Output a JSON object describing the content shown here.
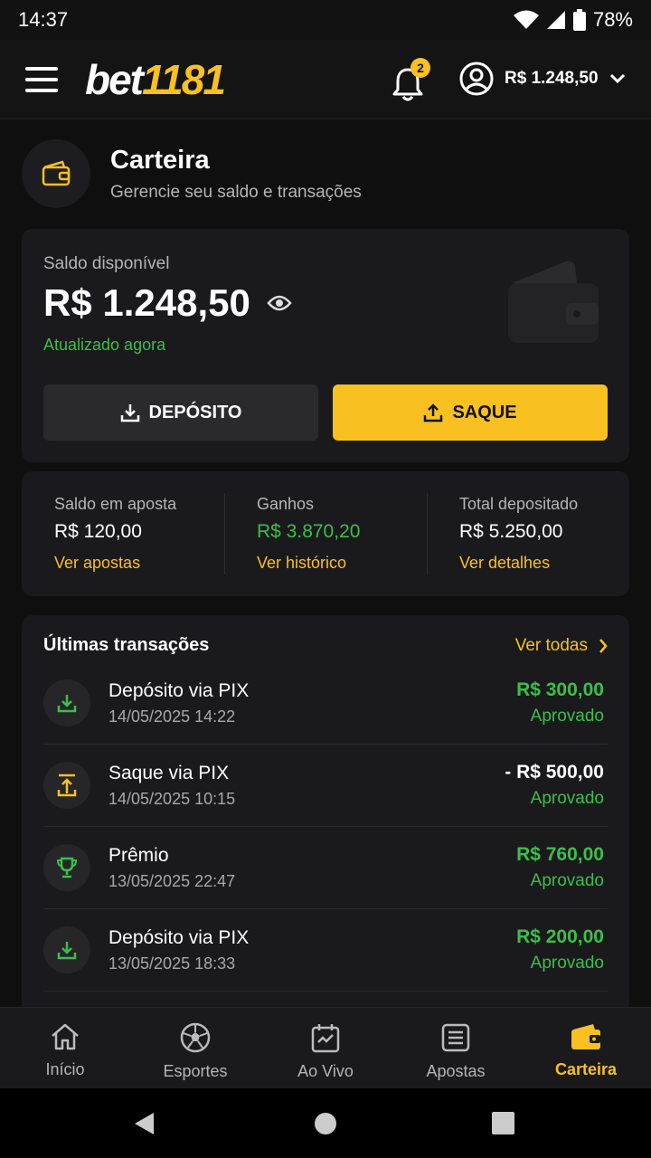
{
  "status_bar": {
    "time": "14:37",
    "battery": "78%"
  },
  "app_bar": {
    "logo_white": "bet",
    "logo_yellow": "1181",
    "notification_count": "2",
    "account_balance": "R$ 1.248,50"
  },
  "page": {
    "title": "Carteira",
    "subtitle": "Gerencie seu saldo e transações"
  },
  "balance": {
    "label": "Saldo disponível",
    "amount": "R$ 1.248,50",
    "updated": "Atualizado agora",
    "deposit_label": "DEPÓSITO",
    "withdraw_label": "SAQUE"
  },
  "stats": [
    {
      "label": "Saldo em aposta",
      "value": "R$ 120,00",
      "link": "Ver apostas"
    },
    {
      "label": "Ganhos",
      "value": "R$ 3.870,20",
      "link": "Ver histórico"
    },
    {
      "label": "Total depositado",
      "value": "R$ 5.250,00",
      "link": "Ver detalhes"
    }
  ],
  "transactions": {
    "title": "Últimas transações",
    "see_all": "Ver todas",
    "items": [
      {
        "name": "Depósito via PIX",
        "date": "14/05/2025 14:22",
        "value": "R$ 300,00",
        "status": "Aprovado",
        "icon": "download-icon"
      },
      {
        "name": "Saque via PIX",
        "date": "14/05/2025 10:15",
        "value": "- R$ 500,00",
        "status": "Aprovado",
        "icon": "upload-icon"
      },
      {
        "name": "Prêmio",
        "date": "13/05/2025 22:47",
        "value": "R$ 760,00",
        "status": "Aprovado",
        "icon": "trophy-icon"
      },
      {
        "name": "Depósito via PIX",
        "date": "13/05/2025 18:33",
        "value": "R$ 200,00",
        "status": "Aprovado",
        "icon": "download-icon"
      }
    ]
  },
  "bottom_nav": [
    {
      "label": "Início",
      "icon": "home-icon"
    },
    {
      "label": "Esportes",
      "icon": "soccer-ball-icon"
    },
    {
      "label": "Ao Vivo",
      "icon": "live-calendar-icon"
    },
    {
      "label": "Apostas",
      "icon": "bet-slip-icon"
    },
    {
      "label": "Carteira",
      "icon": "wallet-icon",
      "active": true
    }
  ],
  "colors": {
    "accent": "#f8c020",
    "positive": "#3bbf4a",
    "background": "#0f0f10",
    "card": "#1a1a1c"
  }
}
